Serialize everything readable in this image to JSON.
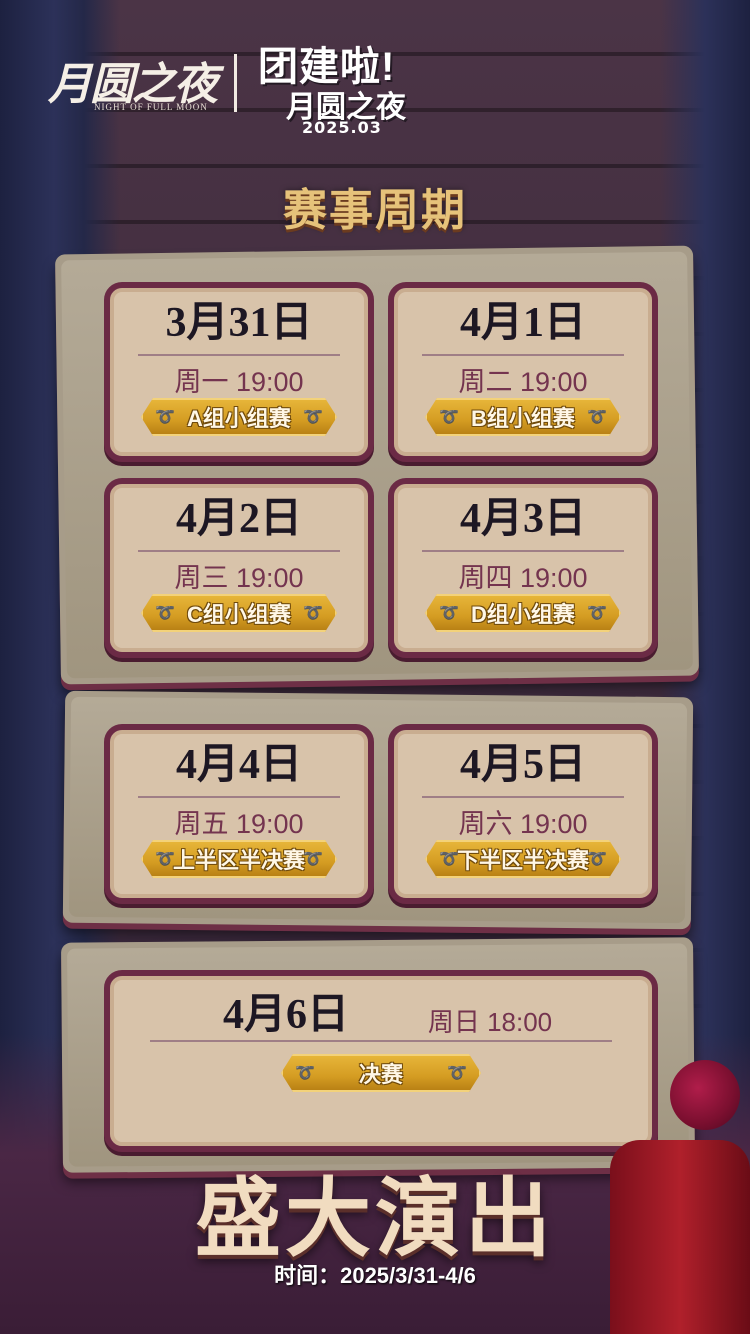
{
  "header": {
    "logo": "月圆之夜",
    "logo_sub": "NIGHT OF FULL MOON",
    "event_title": "团建啦!",
    "event_subtitle": "月圆之夜",
    "event_date": "2025.03"
  },
  "section_title": "赛事周期",
  "schedule": [
    {
      "date": "3月31日",
      "time": "周一 19:00",
      "stage": "A组小组赛"
    },
    {
      "date": "4月1日",
      "time": "周二 19:00",
      "stage": "B组小组赛"
    },
    {
      "date": "4月2日",
      "time": "周三 19:00",
      "stage": "C组小组赛"
    },
    {
      "date": "4月3日",
      "time": "周四 19:00",
      "stage": "D组小组赛"
    },
    {
      "date": "4月4日",
      "time": "周五 19:00",
      "stage": "上半区半决赛"
    },
    {
      "date": "4月5日",
      "time": "周六 19:00",
      "stage": "下半区半决赛"
    },
    {
      "date": "4月6日",
      "time": "周日 18:00",
      "stage": "决赛"
    }
  ],
  "footer": {
    "headline": "盛大演出",
    "period": "时间：2025/3/31-4/6"
  },
  "colors": {
    "card_border": "#6b2a45",
    "badge_gold": "#d49c22",
    "title_gold": "#e6c27a",
    "time_text": "#74344f"
  }
}
